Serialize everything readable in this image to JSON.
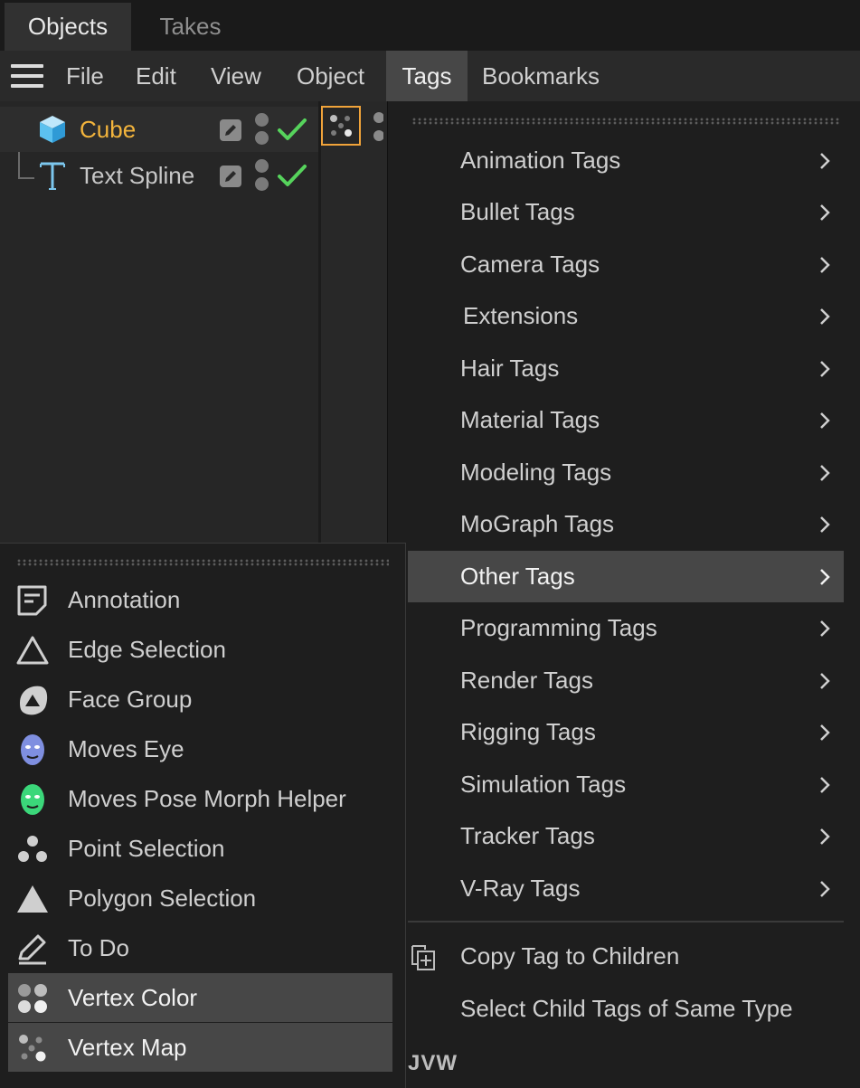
{
  "tabs": {
    "objects": "Objects",
    "takes": "Takes"
  },
  "menubar": {
    "items": [
      {
        "label": "File"
      },
      {
        "label": "Edit"
      },
      {
        "label": "View"
      },
      {
        "label": "Object"
      },
      {
        "label": "Tags",
        "active": true
      },
      {
        "label": "Bookmarks"
      }
    ]
  },
  "objects": [
    {
      "name": "Cube",
      "icon": "cube-icon",
      "selected": true
    },
    {
      "name": "Text Spline",
      "icon": "text-spline-icon",
      "selected": false
    }
  ],
  "tags_menu": {
    "items": [
      {
        "label": "Animation Tags"
      },
      {
        "label": "Bullet Tags"
      },
      {
        "label": "Camera Tags"
      },
      {
        "label": "Extensions"
      },
      {
        "label": "Hair Tags"
      },
      {
        "label": "Material Tags"
      },
      {
        "label": "Modeling Tags"
      },
      {
        "label": "MoGraph Tags"
      },
      {
        "label": "Other Tags",
        "highlighted": true
      },
      {
        "label": "Programming Tags"
      },
      {
        "label": "Render Tags"
      },
      {
        "label": "Rigging Tags"
      },
      {
        "label": "Simulation Tags"
      },
      {
        "label": "Tracker Tags"
      },
      {
        "label": "V-Ray Tags"
      }
    ],
    "actions": [
      {
        "label": "Copy Tag to Children",
        "icon": "copy-to-children-icon"
      },
      {
        "label": "Select Child Tags of Same Type"
      }
    ],
    "footer": "JVW"
  },
  "other_tags_submenu": {
    "items": [
      {
        "label": "Annotation",
        "icon": "annotation-icon"
      },
      {
        "label": "Edge Selection",
        "icon": "edge-selection-icon"
      },
      {
        "label": "Face Group",
        "icon": "face-group-icon"
      },
      {
        "label": "Moves Eye",
        "icon": "moves-eye-icon"
      },
      {
        "label": "Moves Pose Morph Helper",
        "icon": "moves-pose-morph-icon"
      },
      {
        "label": "Point Selection",
        "icon": "point-selection-icon"
      },
      {
        "label": "Polygon Selection",
        "icon": "polygon-selection-icon"
      },
      {
        "label": "To Do",
        "icon": "todo-icon"
      },
      {
        "label": "Vertex Color",
        "icon": "vertex-color-icon",
        "highlighted": true
      },
      {
        "label": "Vertex Map",
        "icon": "vertex-map-icon",
        "highlighted": true
      }
    ]
  },
  "colors": {
    "selected_object": "#f3b43c",
    "check_green": "#56d35c",
    "tag_selection_border": "#f0a33a",
    "highlight_bg": "#474747"
  }
}
